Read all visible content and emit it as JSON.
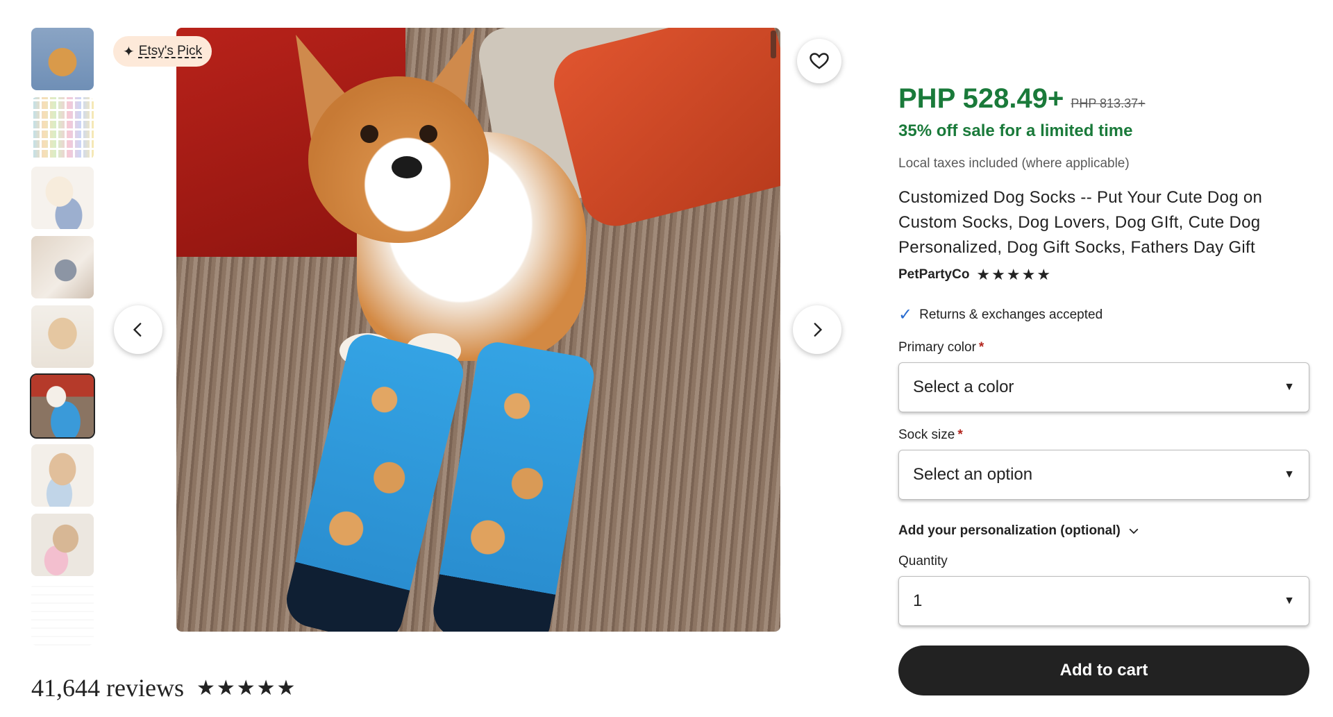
{
  "gallery": {
    "badge_label": "Etsy's Pick",
    "thumbnails": [
      "dog-photo-1",
      "dog-photo-2",
      "dog-photo-3",
      "dog-photo-4",
      "dog-photo-5",
      "dog-photo-6",
      "dog-photo-7",
      "dog-photo-8",
      "dog-photo-9"
    ],
    "selected_index": 5
  },
  "reviews": {
    "count_label": "41,644 reviews",
    "stars": "★★★★★"
  },
  "product": {
    "price": "PHP 528.49+",
    "original_price": "PHP 813.37+",
    "sale_text": "35% off sale for a limited time",
    "tax_note": "Local taxes included (where applicable)",
    "title": "Customized Dog Socks -- Put Your Cute Dog on Custom Socks, Dog Lovers, Dog GIft, Cute Dog Personalized, Dog Gift Socks, Fathers Day Gift",
    "shop_name": "PetPartyCo",
    "shop_stars": "★★★★★",
    "returns": "Returns & exchanges accepted"
  },
  "options": {
    "color_label": "Primary color",
    "color_value": "Select a color",
    "size_label": "Sock size",
    "size_value": "Select an option",
    "required_mark": "*",
    "personalization_label": "Add your personalization (optional)",
    "quantity_label": "Quantity",
    "quantity_value": "1"
  },
  "actions": {
    "add_to_cart": "Add to cart"
  },
  "colors": {
    "price_green": "#1a7a3a",
    "button_dark": "#222222",
    "check_blue": "#2a6dd1",
    "required_red": "#b3261e"
  }
}
